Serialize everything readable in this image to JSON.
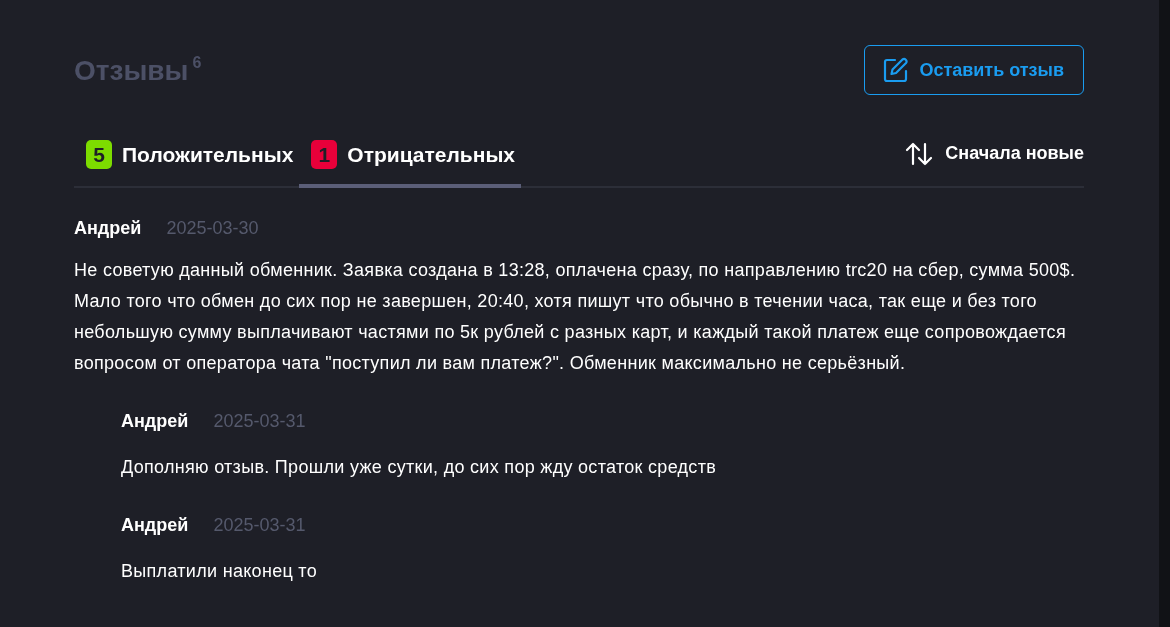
{
  "header": {
    "title": "Отзывы",
    "count": "6",
    "button": "Оставить отзыв"
  },
  "tabs": [
    {
      "count": "5",
      "label": "Положительных",
      "color": "#7ddc00",
      "selected": false
    },
    {
      "count": "1",
      "label": "Отрицательных",
      "color": "#e8003a",
      "selected": true
    }
  ],
  "sort": {
    "label": "Сначала новые"
  },
  "reviews": [
    {
      "author": "Андрей",
      "date": "2025-03-30",
      "text": "Не советую данный обменник. Заявка создана в 13:28, оплачена сразу, по направлению trc20 на сбер, сумма 500$. Мало того что обмен до сих пор не завершен, 20:40, хотя пишут что обычно в течении часа, так еще и без того небольшую сумму выплачивают частями по 5к рублей с разных карт, и каждый такой платеж еще сопровождается вопросом от оператора чата \"поступил ли вам платеж?\". Обменник максимально не серьёзный.",
      "children": [
        {
          "author": "Андрей",
          "date": "2025-03-31",
          "text": "Дополняю отзыв. Прошли уже сутки, до сих пор жду остаток средств"
        },
        {
          "author": "Андрей",
          "date": "2025-03-31",
          "text": "Выплатили наконец то"
        }
      ]
    }
  ]
}
